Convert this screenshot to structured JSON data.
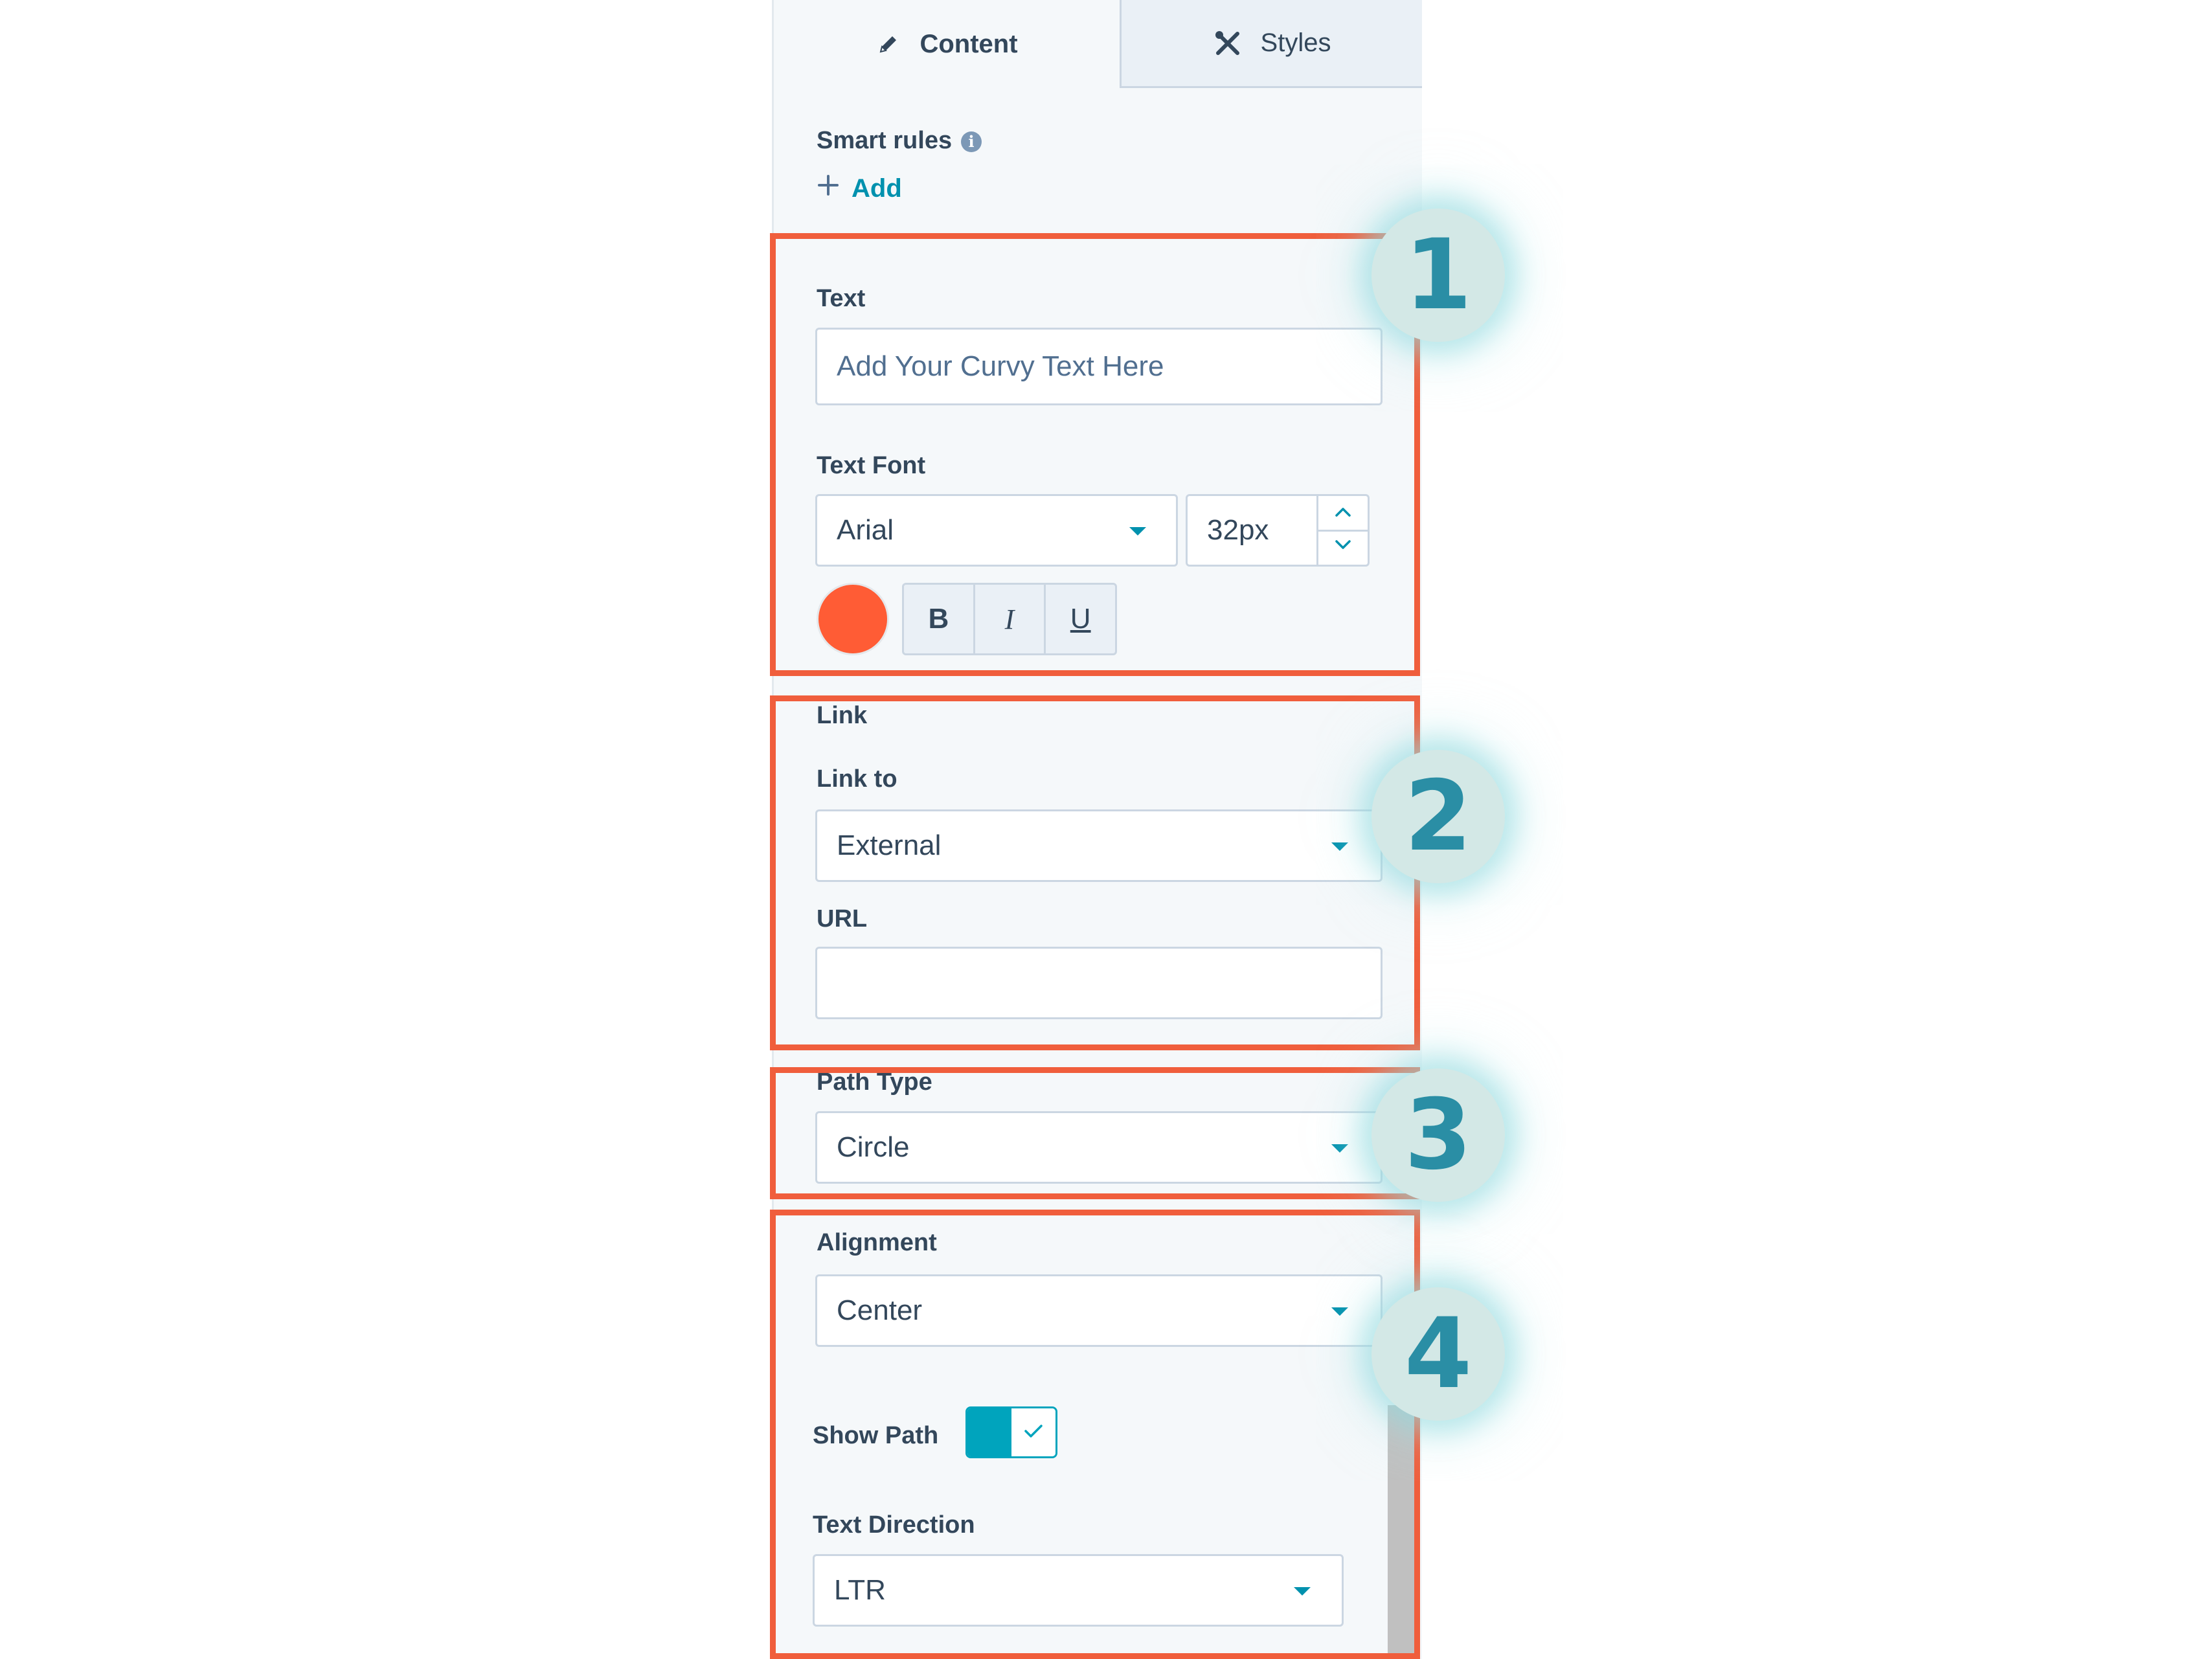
{
  "tabs": [
    {
      "label": "Content",
      "icon": "pencil-icon",
      "active": true
    },
    {
      "label": "Styles",
      "icon": "tools-icon",
      "active": false
    }
  ],
  "smart_rules": {
    "label": "Smart rules",
    "add_label": "Add"
  },
  "text_section": {
    "label": "Text",
    "text_value": "Add Your Curvy Text Here",
    "font_label": "Text Font",
    "font_value": "Arial",
    "size_value": "32px",
    "text_color": "#ff5c35",
    "bold_label": "B",
    "italic_label": "I",
    "underline_label": "U"
  },
  "link_section": {
    "label": "Link",
    "link_to_label": "Link to",
    "link_to_value": "External",
    "url_label": "URL",
    "url_value": ""
  },
  "path_section": {
    "label": "Path Type",
    "value": "Circle"
  },
  "alignment_section": {
    "label": "Alignment",
    "value": "Center",
    "show_path_label": "Show Path",
    "show_path_on": true,
    "direction_label": "Text Direction",
    "direction_value": "LTR"
  },
  "callouts": [
    "1",
    "2",
    "3",
    "4"
  ],
  "colors": {
    "accent": "#0091ae",
    "highlight": "#f05e3c",
    "badge_fill": "#d3e8e6",
    "badge_text": "#2a8ea5"
  }
}
